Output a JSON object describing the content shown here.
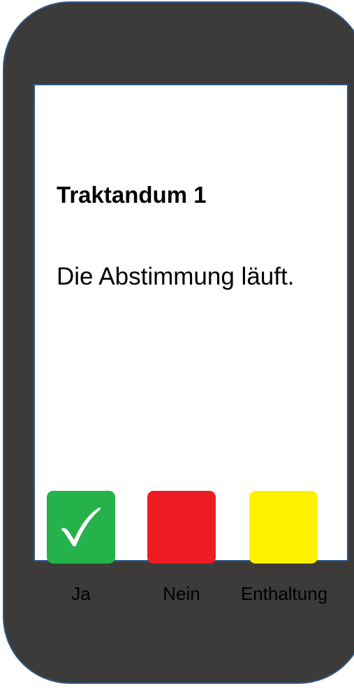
{
  "agenda": {
    "title": "Traktandum 1",
    "message": "Die Abstimmung läuft."
  },
  "vote_options": [
    {
      "label": "Ja",
      "color": "#25b24a",
      "icon": "checkmark-icon"
    },
    {
      "label": "Nein",
      "color": "#ed1c24"
    },
    {
      "label": "Enthaltung",
      "color": "#fff200"
    }
  ],
  "colors": {
    "device_body": "#3d3b39",
    "outline": "#2f5887",
    "screen": "#ffffff"
  }
}
